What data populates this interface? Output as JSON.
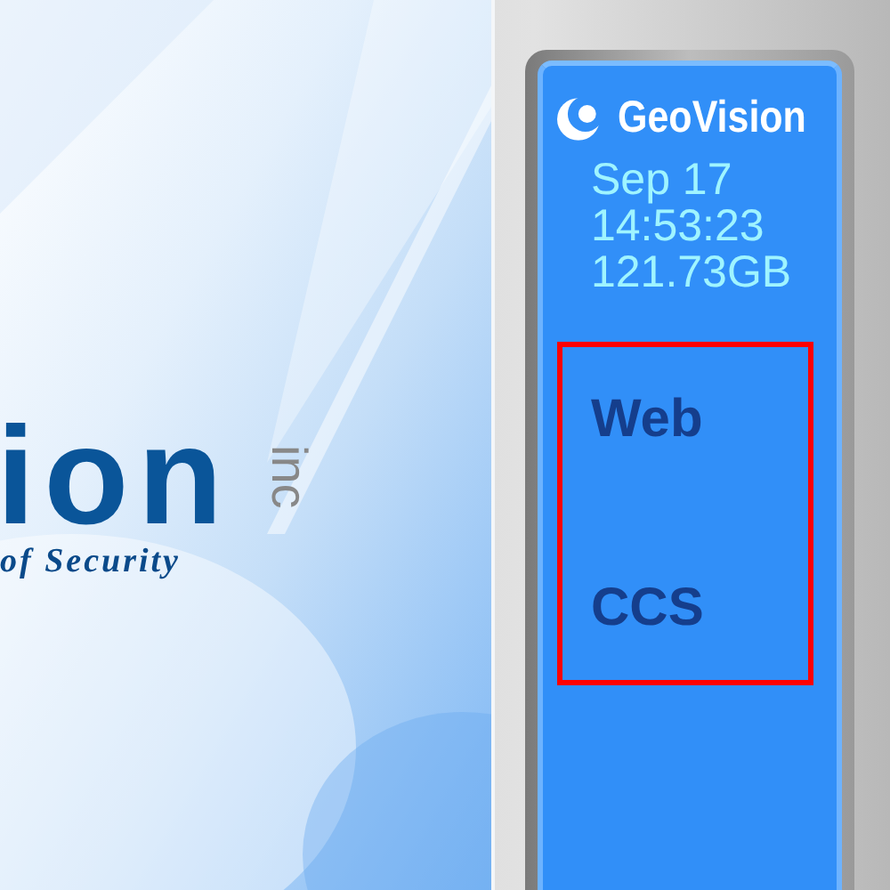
{
  "splash": {
    "wordmark": "ion",
    "suffix": "inc",
    "tagline": "of Security"
  },
  "status_panel": {
    "brand": "GeoVision",
    "date": "Sep 17",
    "time": "14:53:23",
    "storage": "121.73GB",
    "links": [
      {
        "label": "Web"
      },
      {
        "label": "CCS"
      }
    ]
  }
}
